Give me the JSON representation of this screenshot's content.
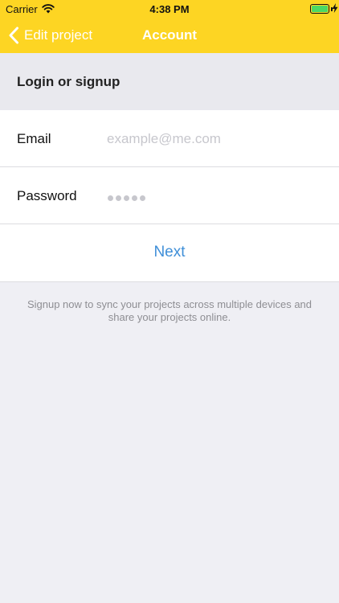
{
  "status_bar": {
    "carrier": "Carrier",
    "time": "4:38 PM",
    "battery_level": 1.0,
    "battery_color": "#4cd964"
  },
  "nav": {
    "back_label": "Edit project",
    "title": "Account",
    "bar_color": "#fdd523"
  },
  "section": {
    "header": "Login or signup"
  },
  "form": {
    "email_label": "Email",
    "email_placeholder": "example@me.com",
    "email_value": "",
    "password_label": "Password",
    "password_dot_count": 5
  },
  "next_label": "Next",
  "footer_note": "Signup now to sync your projects across multiple devices and share your projects online.",
  "colors": {
    "accent": "#3f8fd8",
    "background": "#efeff4"
  }
}
